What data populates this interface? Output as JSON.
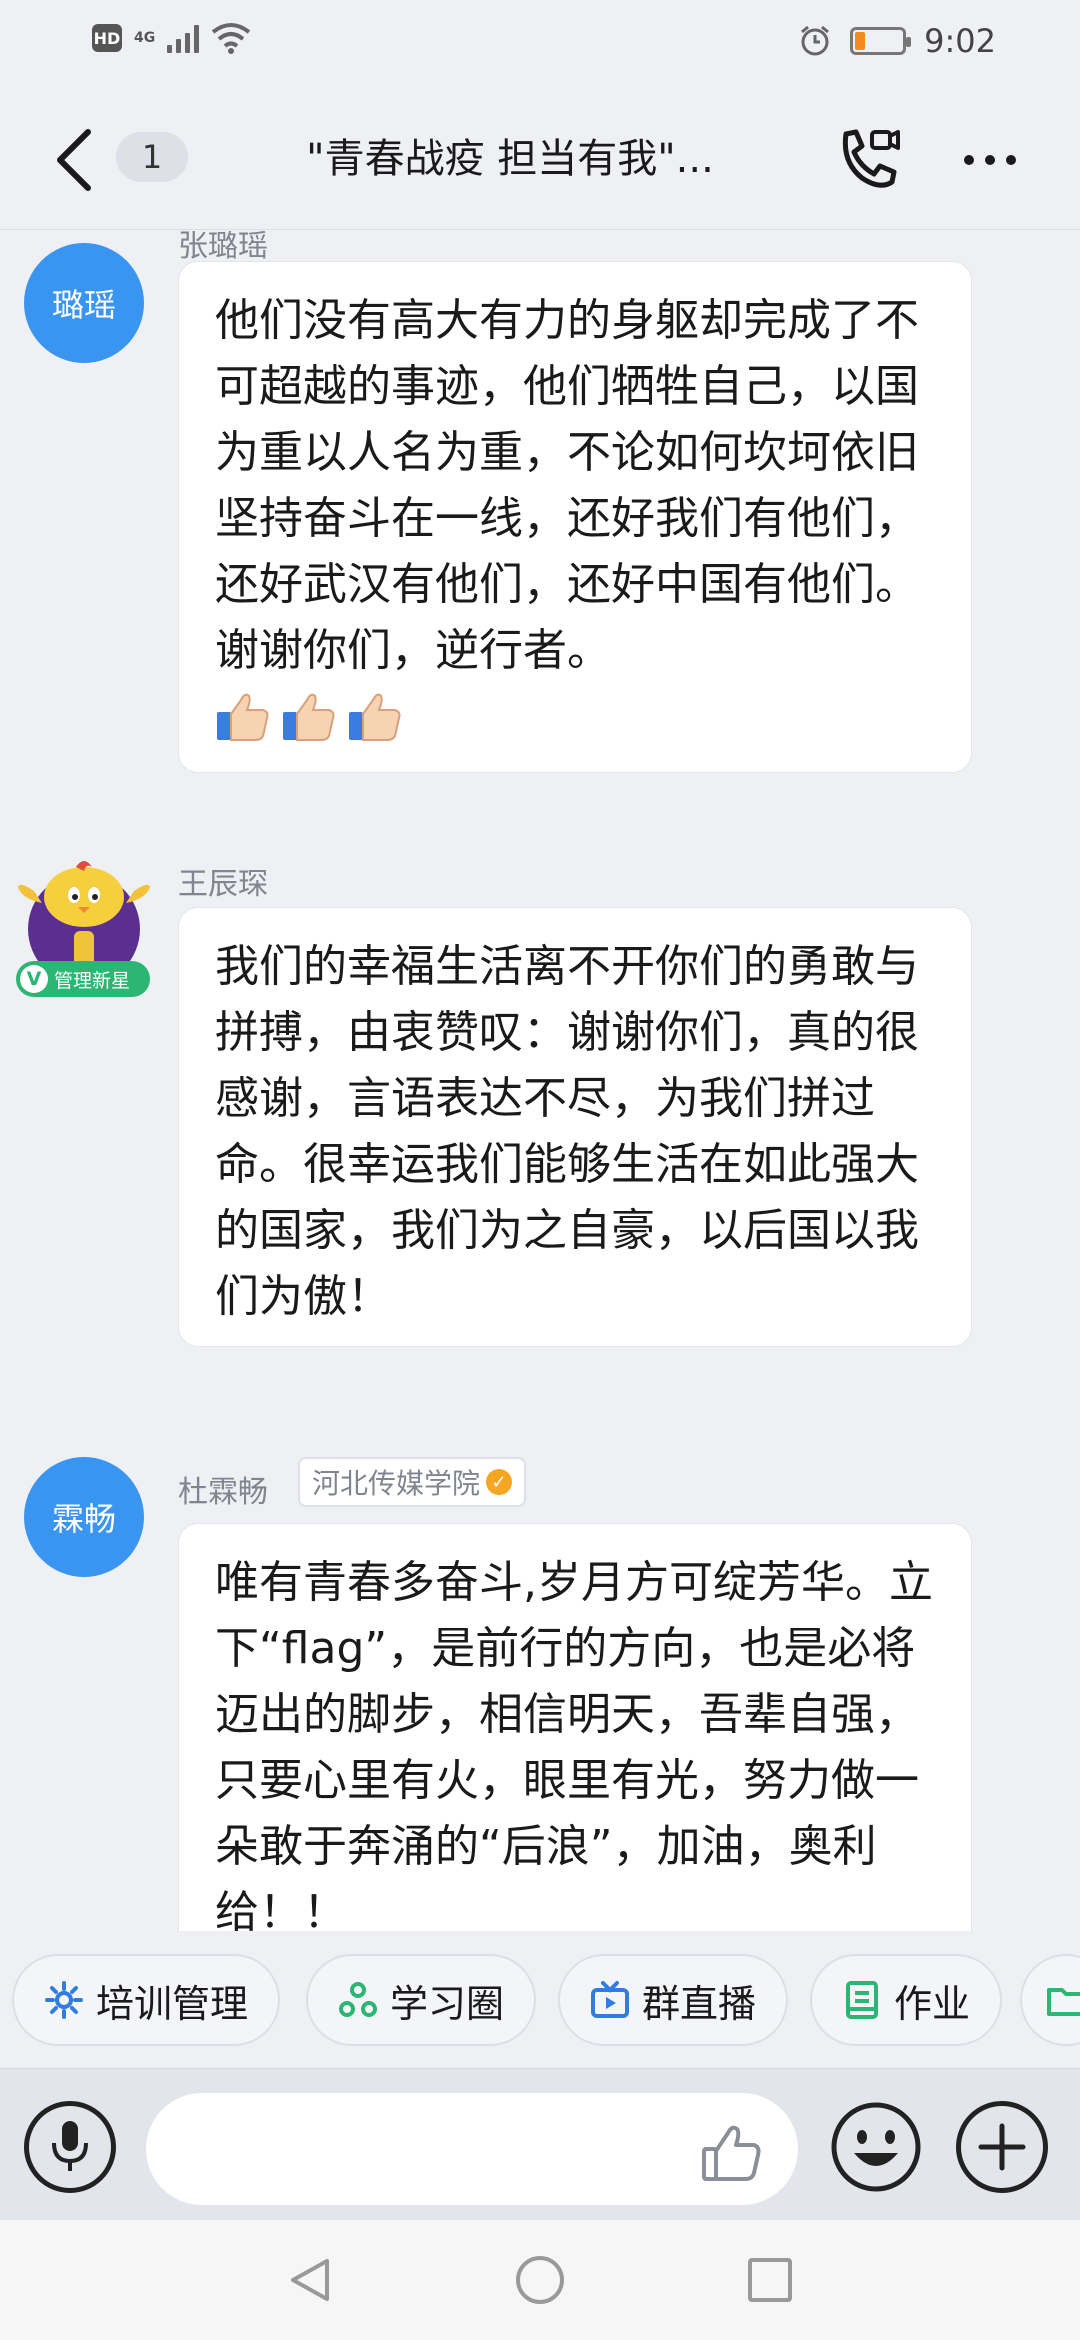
{
  "status_bar": {
    "hd": "HD",
    "network": "4G",
    "time": "9:02",
    "battery_level": 0.2
  },
  "header": {
    "unread_count": "1",
    "title": "\"青春战疫 担当有我\"..."
  },
  "messages": [
    {
      "sender": "张璐瑶",
      "avatar_text": "璐瑶",
      "text": "他们没有高大有力的身躯却完成了不可超越的事迹，他们牺牲自己，以国为重以人名为重，不论如何坎坷依旧坚持奋斗在一线，还好我们有他们，还好武汉有他们，还好中国有他们。谢谢你们，逆行者。",
      "emoji_count": 3
    },
    {
      "sender": "王辰琛",
      "badge": "管理新星",
      "badge_letter": "V",
      "text": "我们的幸福生活离不开你们的勇敢与拼搏，由衷赞叹：谢谢你们，真的很感谢，言语表达不尽，为我们拼过命。很幸运我们能够生活在如此强大的国家，我们为之自豪，以后国以我们为傲！"
    },
    {
      "sender": "杜霖畅",
      "avatar_text": "霖畅",
      "tag": "河北传媒学院",
      "text": "唯有青春多奋斗,岁月方可绽芳华。立下“flag”，是前行的方向，也是必将迈出的脚步，相信明天，吾辈自强，只要心里有火，眼里有光，努力做一朵敢于奔涌的“后浪”，加油，奥利给！！"
    }
  ],
  "quick_actions": [
    {
      "label": "培训管理",
      "icon": "gear-icon",
      "color": "#2f7de1"
    },
    {
      "label": "学习圈",
      "icon": "circles-icon",
      "color": "#2bb673"
    },
    {
      "label": "群直播",
      "icon": "tv-icon",
      "color": "#2f7de1"
    },
    {
      "label": "作业",
      "icon": "notebook-icon",
      "color": "#2bb673"
    }
  ],
  "colors": {
    "accent": "#3a95f0",
    "background": "#eef0f4",
    "badge_green": "#2bb673",
    "verified": "#f5a623"
  }
}
